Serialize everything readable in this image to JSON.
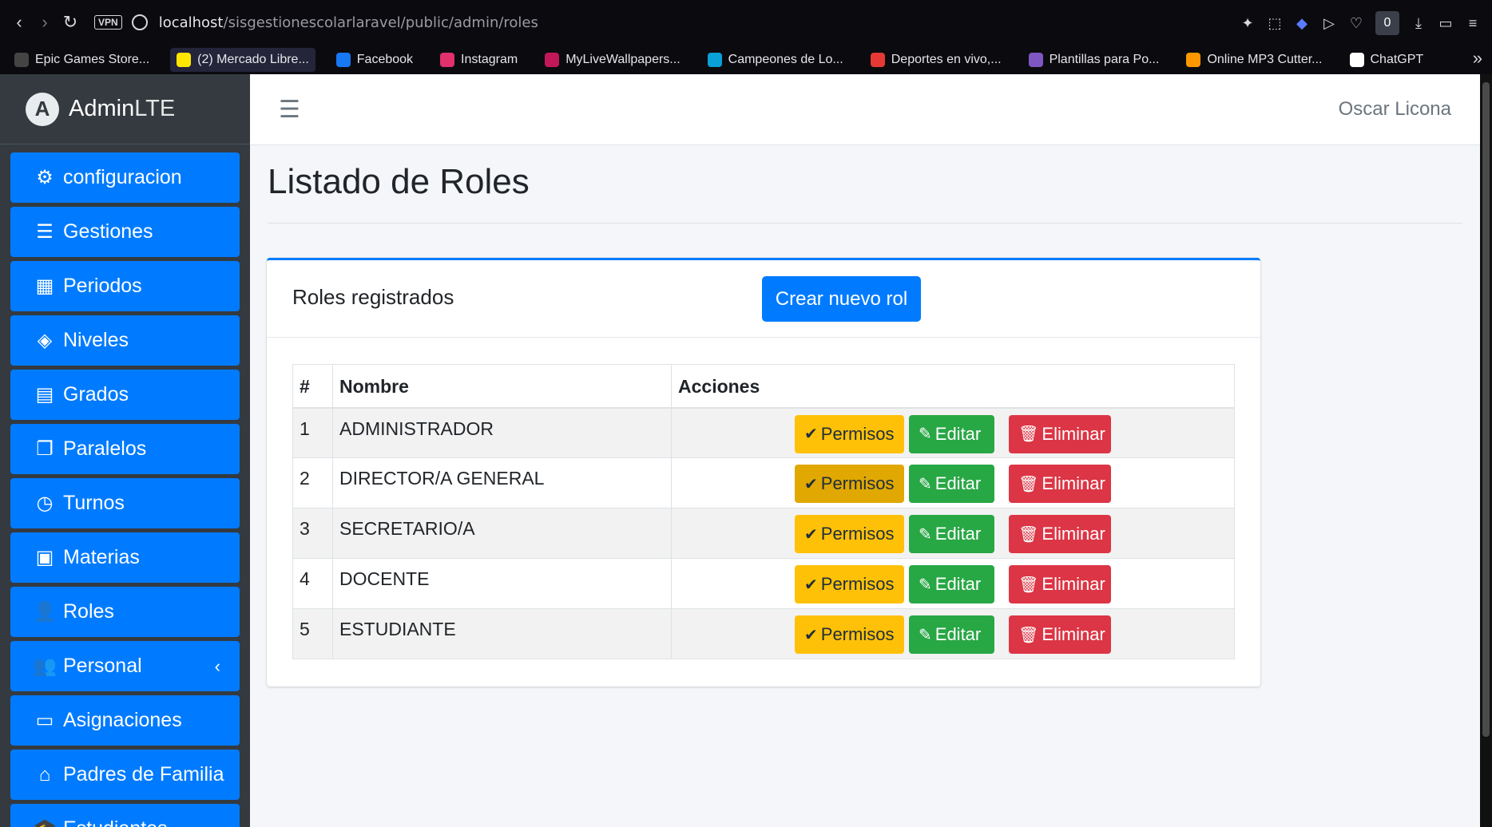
{
  "browser": {
    "url_host": "localhost",
    "url_path": "/sisgestionescolarlaravel/public/admin/roles",
    "vpn_label": "VPN",
    "badge_count": "0",
    "bookmarks": [
      {
        "label": "Epic Games Store...",
        "color": "#444"
      },
      {
        "label": "(2) Mercado Libre...",
        "color": "#ffe600"
      },
      {
        "label": "Facebook",
        "color": "#1877f2"
      },
      {
        "label": "Instagram",
        "color": "#e1306c"
      },
      {
        "label": "MyLiveWallpapers...",
        "color": "#c2185b"
      },
      {
        "label": "Campeones de Lo...",
        "color": "#0aa0d8"
      },
      {
        "label": "Deportes en vivo,...",
        "color": "#e53935"
      },
      {
        "label": "Plantillas para Po...",
        "color": "#7e57c2"
      },
      {
        "label": "Online MP3 Cutter...",
        "color": "#ff9800"
      },
      {
        "label": "ChatGPT",
        "color": "#ffffff"
      }
    ]
  },
  "brand": {
    "bold": "Admin",
    "light": "LTE",
    "logo_letter": "A"
  },
  "sidebar": {
    "items": [
      {
        "label": "configuracion",
        "icon": "⚙"
      },
      {
        "label": "Gestiones",
        "icon": "☰"
      },
      {
        "label": "Periodos",
        "icon": "▦"
      },
      {
        "label": "Niveles",
        "icon": "◈"
      },
      {
        "label": "Grados",
        "icon": "▤"
      },
      {
        "label": "Paralelos",
        "icon": "❐"
      },
      {
        "label": "Turnos",
        "icon": "◷"
      },
      {
        "label": "Materias",
        "icon": "▣"
      },
      {
        "label": "Roles",
        "icon": "👤"
      },
      {
        "label": "Personal",
        "icon": "👥",
        "chevron": "‹"
      },
      {
        "label": "Asignaciones",
        "icon": "▭"
      },
      {
        "label": "Padres de Familia",
        "icon": "⌂"
      },
      {
        "label": "Estudiantes",
        "icon": "🎓"
      }
    ]
  },
  "topnav": {
    "user": "Oscar Licona"
  },
  "page": {
    "title": "Listado de Roles"
  },
  "card": {
    "title": "Roles registrados",
    "create_label": "Crear nuevo rol"
  },
  "table": {
    "headers": [
      "#",
      "Nombre",
      "Acciones"
    ],
    "rows": [
      {
        "num": "1",
        "name": "ADMINISTRADOR"
      },
      {
        "num": "2",
        "name": "DIRECTOR/A GENERAL"
      },
      {
        "num": "3",
        "name": "SECRETARIO/A"
      },
      {
        "num": "4",
        "name": "DOCENTE"
      },
      {
        "num": "5",
        "name": "ESTUDIANTE"
      }
    ],
    "actions": {
      "permisos": "Permisos",
      "editar": "Editar",
      "eliminar": "Eliminar"
    }
  },
  "colors": {
    "primary": "#007bff",
    "warning": "#ffc107",
    "success": "#28a745",
    "danger": "#dc3545",
    "sidebar": "#343a40"
  }
}
